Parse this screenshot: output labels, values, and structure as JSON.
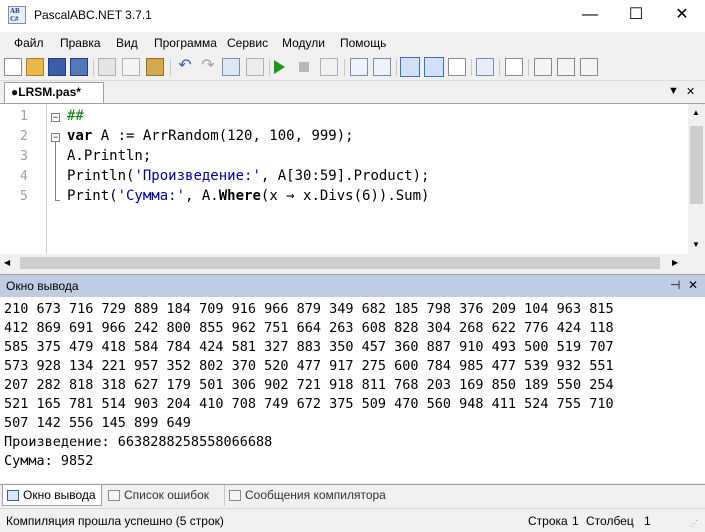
{
  "window": {
    "title": "PascalABC.NET 3.7.1",
    "icon_text": "AB C#",
    "minimize": "—",
    "maximize": "☐",
    "close": "✕"
  },
  "menu": [
    "Файл",
    "Правка",
    "Вид",
    "Программа",
    "Сервис",
    "Модули",
    "Помощь"
  ],
  "editor_tab": {
    "label": "●LRSM.pas*",
    "close_label": "✕",
    "dropdown_label": "▼",
    "pin_label": "✕"
  },
  "editor": {
    "line_numbers": [
      "1",
      "2",
      "3",
      "4",
      "5"
    ],
    "lines": [
      {
        "parts": [
          {
            "t": "##",
            "c": "cmt"
          }
        ]
      },
      {
        "parts": [
          {
            "t": "var",
            "c": "kw"
          },
          {
            "t": " A := ArrRandom(120, 100, 999);",
            "c": ""
          }
        ]
      },
      {
        "parts": [
          {
            "t": "A.Println;",
            "c": ""
          }
        ]
      },
      {
        "parts": [
          {
            "t": "Println(",
            "c": ""
          },
          {
            "t": "'Произведение:'",
            "c": "str"
          },
          {
            "t": ", A[30:59].Product);",
            "c": ""
          }
        ]
      },
      {
        "parts": [
          {
            "t": "Print(",
            "c": ""
          },
          {
            "t": "'Сумма:'",
            "c": "str"
          },
          {
            "t": ", A.",
            "c": ""
          },
          {
            "t": "Where",
            "c": "kw"
          },
          {
            "t": "(x → x.Divs(6)).Sum)",
            "c": ""
          }
        ]
      }
    ]
  },
  "output_panel": {
    "title": "Окно вывода",
    "pin": "⊣",
    "close": "✕",
    "lines": [
      "210 673 716 729 889 184 709 916 966 879 349 682 185 798 376 209 104 963 815",
      "412 869 691 966 242 800 855 962 751 664 263 608 828 304 268 622 776 424 118",
      "585 375 479 418 584 784 424 581 327 883 350 457 360 887 910 493 500 519 707",
      "573 928 134 221 957 352 802 370 520 477 917 275 600 784 985 477 539 932 551",
      "207 282 818 318 627 179 501 306 902 721 918 811 768 203 169 850 189 550 254",
      "521 165 781 514 903 204 410 708 749 672 375 509 470 560 948 411 524 755 710",
      "507 142 556 145 899 649",
      "Произведение: 6638288258558066688",
      "Сумма: 9852"
    ]
  },
  "bottom_tabs": [
    {
      "label": "Окно вывода",
      "icon": "output-window-icon"
    },
    {
      "label": "Список ошибок",
      "icon": "error-list-icon"
    },
    {
      "label": "Сообщения компилятора",
      "icon": "compiler-messages-icon"
    }
  ],
  "status": {
    "message": "Компиляция прошла успешно (5 строк)",
    "row_label": "Строка",
    "row": "1",
    "col_label": "Столбец",
    "col": "1"
  },
  "toolbar_icons": [
    "new-file-icon",
    "open-folder-icon",
    "save-icon",
    "save-all-icon",
    "cut-icon",
    "copy-icon",
    "paste-icon",
    "undo-icon",
    "redo-icon",
    "navigate-back-icon",
    "navigate-forward-icon",
    "run-icon",
    "stop-icon",
    "step-icon",
    "comment-icon",
    "format-icon",
    "output-window-toggle-icon",
    "text-icon",
    "debug-icon",
    "compile-icon",
    "form-designer-icon",
    "breakpoint-icon",
    "step-into-icon",
    "step-over-icon",
    "step-out-icon"
  ],
  "colors": {
    "output_header": "#bfcde4",
    "run_green": "#1a9a1a",
    "string_blue": "#0000a0",
    "comment_green": "#008000"
  }
}
